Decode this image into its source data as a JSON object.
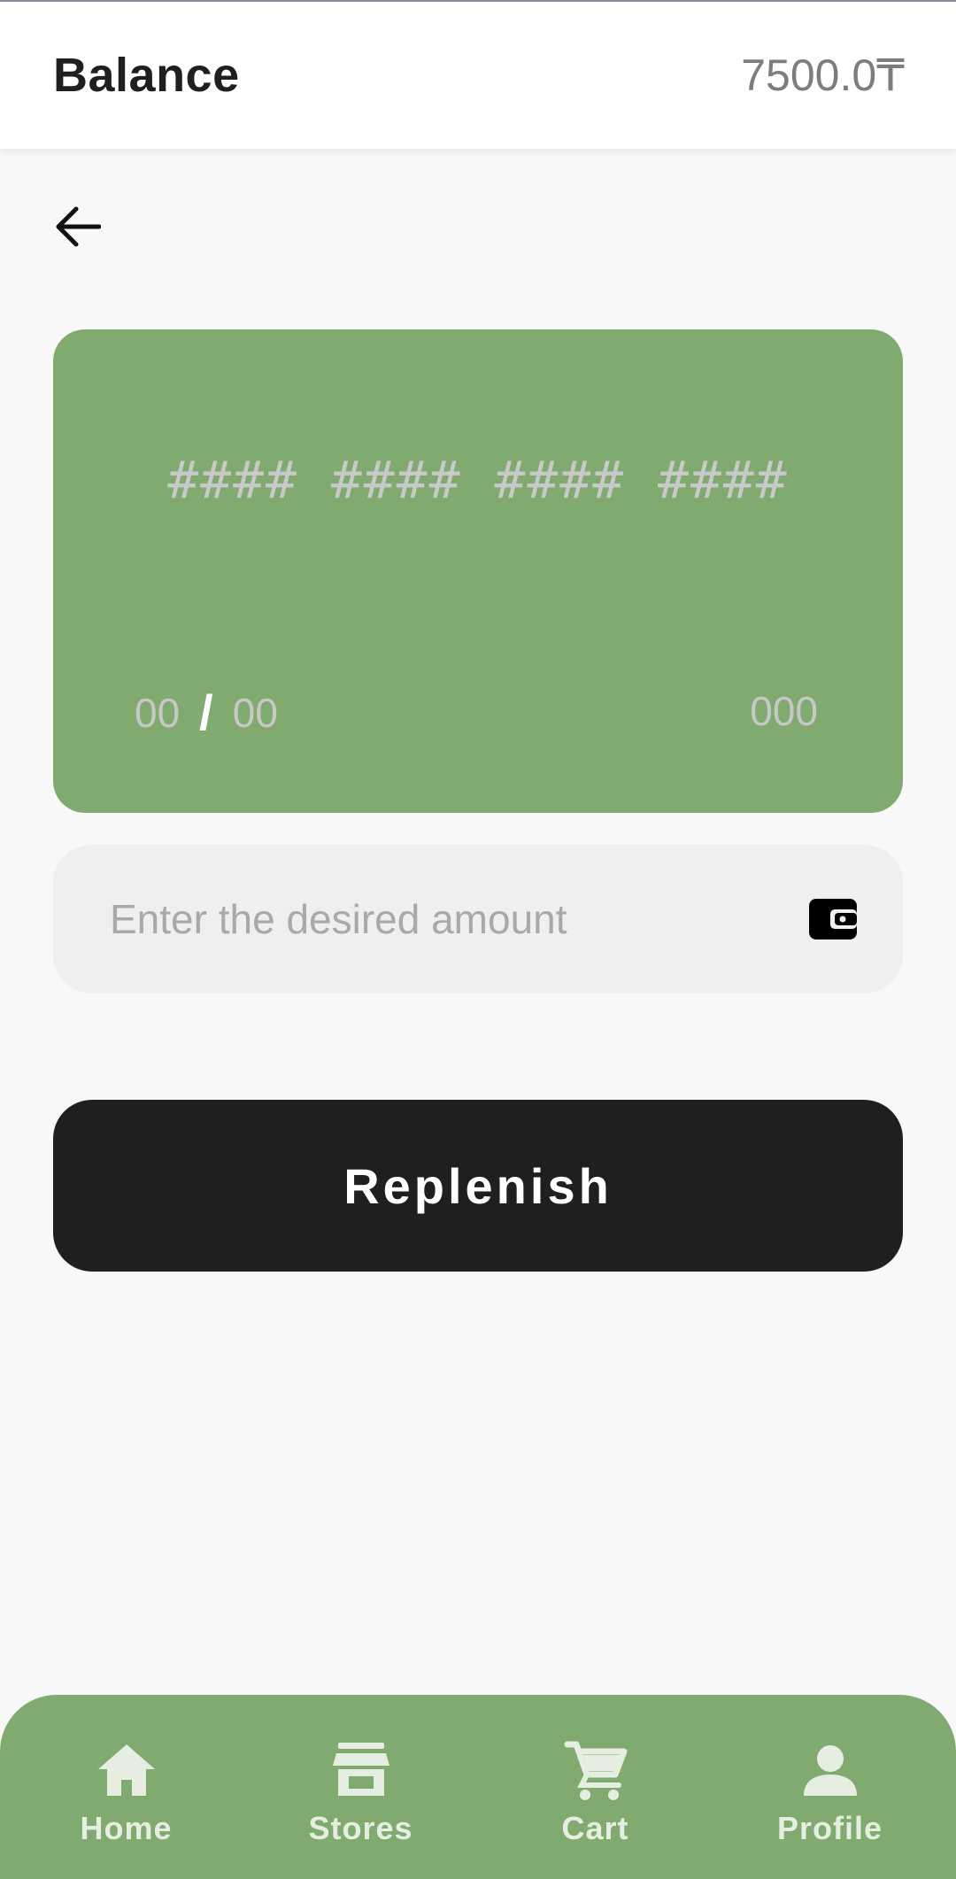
{
  "header": {
    "title": "Balance",
    "balance": "7500.0₸"
  },
  "icons": {
    "back": "arrow-left-icon",
    "wallet": "wallet-icon",
    "home": "home-icon",
    "stores": "store-icon",
    "cart": "cart-icon",
    "profile": "person-icon"
  },
  "card": {
    "number_placeholder": "#### #### #### ####",
    "expiry_month": "00",
    "expiry_separator": "/",
    "expiry_year": "00",
    "cvv": "000",
    "color": "#80aa6f"
  },
  "amount": {
    "placeholder": "Enter the desired amount",
    "value": ""
  },
  "actions": {
    "replenish_label": "Replenish"
  },
  "nav": {
    "items": [
      {
        "label": "Home"
      },
      {
        "label": "Stores"
      },
      {
        "label": "Cart"
      },
      {
        "label": "Profile"
      }
    ]
  },
  "colors": {
    "accent": "#80aa6f",
    "button": "#1f1f1f",
    "nav_text": "#e6eee2"
  }
}
